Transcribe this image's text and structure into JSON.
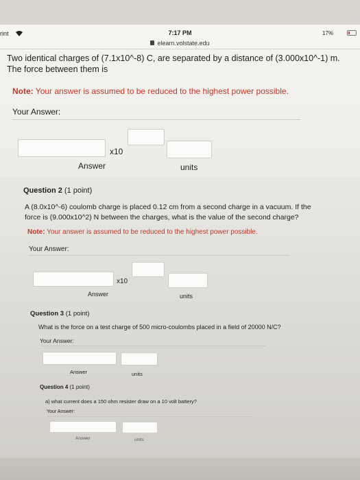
{
  "status": {
    "carrier": "rint",
    "time": "7:17 PM",
    "url": "elearn.volstate.edu",
    "battery": "17%"
  },
  "q1": {
    "text_line1": "Two identical charges of (7.1x10^-8) C, are separated by a distance of (3.000x10^-1) m.",
    "text_line2": "The force between them is",
    "note_label": "Note:",
    "note_text": "Your answer is assumed to be reduced to the highest power possible.",
    "your_answer": "Your Answer:",
    "x10": "x10",
    "answer_label": "Answer",
    "units_label": "units"
  },
  "q2": {
    "title": "Question 2",
    "points": "(1 point)",
    "text_line1": "A (8.0x10^-6) coulomb charge is placed 0.12 cm from a second charge in a vacuum. If the",
    "text_line2": "force is (9.000x10^2) N between the charges, what is the value of the second charge?",
    "note_label": "Note:",
    "note_text": "Your answer is assumed to be reduced to the highest power possible.",
    "your_answer": "Your Answer:",
    "x10": "x10",
    "answer_label": "Answer",
    "units_label": "units"
  },
  "q3": {
    "title": "Question 3",
    "points": "(1 point)",
    "text": "What is the force on a test charge of 500 micro-coulombs placed in a field of 20000 N/C?",
    "your_answer": "Your Answer:",
    "answer_label": "Answer",
    "units_label": "units"
  },
  "q4": {
    "title": "Question 4",
    "points": "(1 point)",
    "text": "a) what current does a 150 ohm resister draw on a 10 volt battery?",
    "your_answer": "Your Answer:",
    "answer_label": "Answer",
    "units_label": "units"
  }
}
